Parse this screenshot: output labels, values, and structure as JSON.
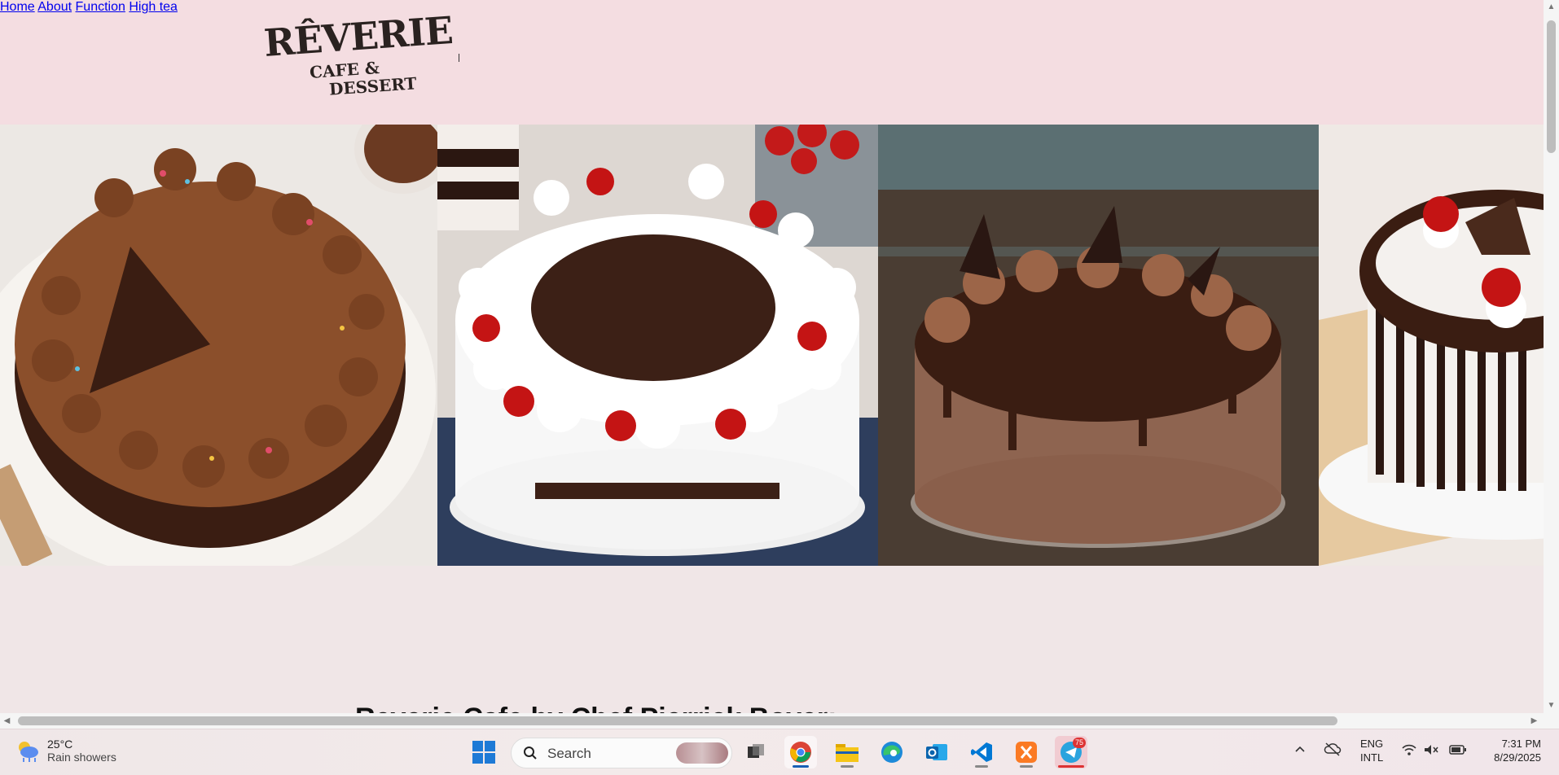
{
  "brand": {
    "logo_main": "RÊVERIE",
    "logo_line1": "CAFE &",
    "logo_line2": "DESSERT"
  },
  "nav": {
    "items": [
      "Home",
      "About",
      "Function",
      "High tea"
    ]
  },
  "gallery": {
    "images": [
      "chocolate-frosted-cake",
      "black-forest-cake",
      "chocolate-drip-cake",
      "cherry-chocolate-cake"
    ]
  },
  "content": {
    "heading": "Reverie Cafe by Chef Pierrick Boyer:"
  },
  "taskbar": {
    "weather_temp": "25°C",
    "weather_condition": "Rain showers",
    "search_label": "Search",
    "telegram_badge": "75",
    "lang_line1": "ENG",
    "lang_line2": "INTL",
    "time": "7:31 PM",
    "date": "8/29/2025"
  },
  "colors": {
    "header_bg": "#f4dde1",
    "page_bg": "#f0e6e7",
    "nav_text": "#4b1c87"
  }
}
